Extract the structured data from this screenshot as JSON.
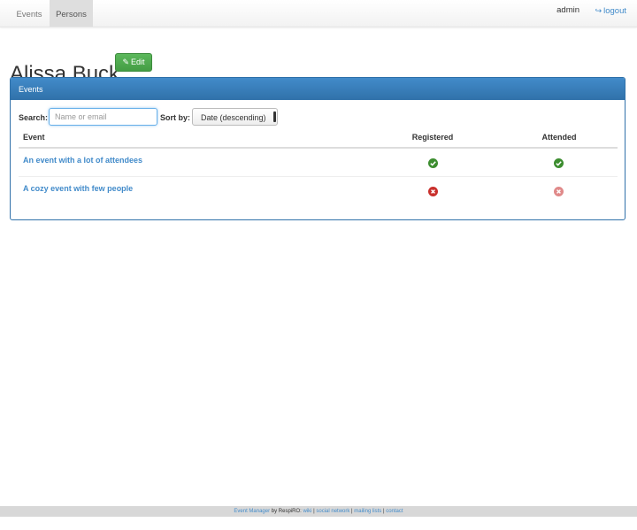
{
  "nav": {
    "tabs": [
      {
        "label": "Events",
        "active": false
      },
      {
        "label": "Persons",
        "active": true
      }
    ],
    "user": "admin",
    "logout_label": "logout",
    "logout_icon": "sign-out-icon"
  },
  "page": {
    "title": "Alissa Buck",
    "edit_label": "Edit",
    "edit_icon": "edit-icon"
  },
  "panel": {
    "heading": "Events",
    "search": {
      "label": "Search:",
      "value": "",
      "placeholder": "Name or email"
    },
    "sort": {
      "label": "Sort by:",
      "selected": "Date (descending)"
    },
    "table": {
      "columns": [
        "Event",
        "Registered",
        "Attended"
      ],
      "rows": [
        {
          "event": "An event with a lot of attendees",
          "registered": "yes",
          "attended": "yes"
        },
        {
          "event": "A cozy event with few people",
          "registered": "no",
          "attended": "no"
        }
      ]
    }
  },
  "colors": {
    "primary": "#428bca",
    "success": "#5cb85c",
    "status_yes": "#3c8d2f",
    "status_no": "#c9302c",
    "status_no_muted": "#e08a8a"
  },
  "footer": {
    "app_link": "Event Manager",
    "by_text": " by RespiRO: ",
    "links": [
      "wiki",
      "social network",
      "mailing lists",
      "contact"
    ],
    "separator": " | "
  }
}
